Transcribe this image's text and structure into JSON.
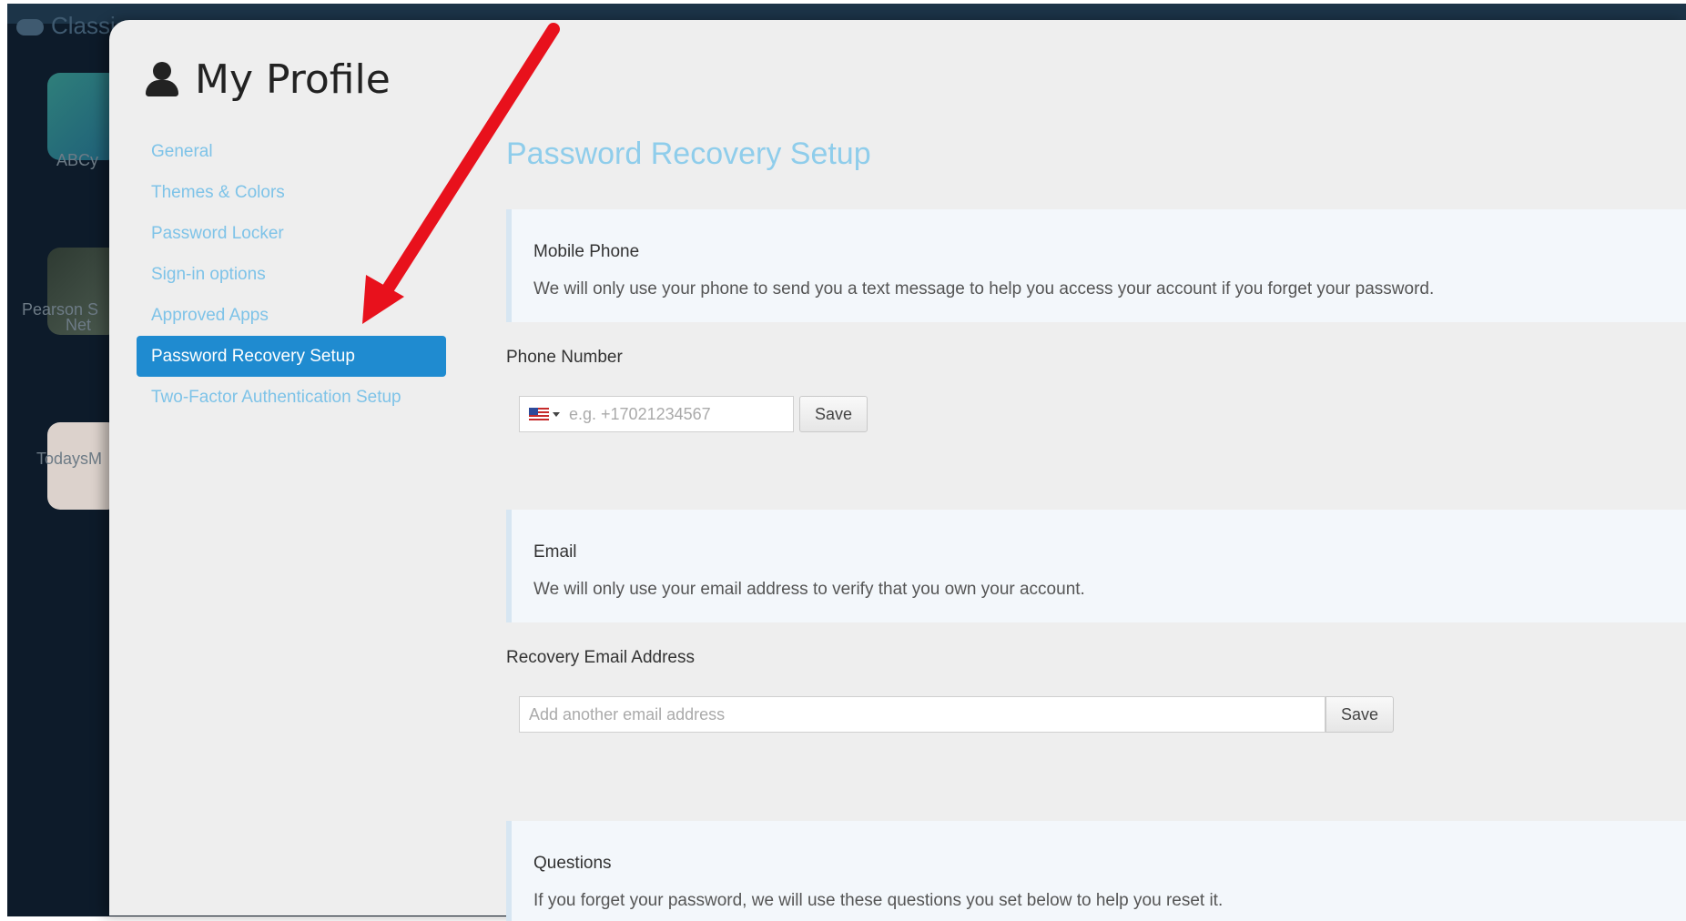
{
  "background": {
    "brand_text": "Classi",
    "tiles": [
      {
        "label": "ABCy"
      },
      {
        "label": "Pearson S"
      },
      {
        "label": "Net"
      },
      {
        "label": "TodaysM"
      }
    ]
  },
  "profile": {
    "title": "My Profile"
  },
  "nav": {
    "items": [
      {
        "label": "General"
      },
      {
        "label": "Themes & Colors"
      },
      {
        "label": "Password Locker"
      },
      {
        "label": "Sign-in options"
      },
      {
        "label": "Approved Apps"
      },
      {
        "label": "Password Recovery Setup",
        "active": true
      },
      {
        "label": "Two-Factor Authentication Setup"
      }
    ]
  },
  "page": {
    "section_title": "Password Recovery Setup"
  },
  "mobile": {
    "title": "Mobile Phone",
    "description": "We will only use your phone to send you a text message to help you access your account if you forget your password.",
    "field_label": "Phone Number",
    "placeholder": "e.g. +17021234567",
    "save_label": "Save",
    "country_icon": "us-flag-icon"
  },
  "email": {
    "title": "Email",
    "description": "We will only use your email address to verify that you own your account.",
    "field_label": "Recovery Email Address",
    "placeholder": "Add another email address",
    "save_label": "Save"
  },
  "questions": {
    "title": "Questions",
    "description": "If you forget your password, we will use these questions you set below to help you reset it."
  },
  "colors": {
    "accent": "#1f8bd0",
    "link": "#7ec3e8",
    "annotation_arrow": "#e8111c"
  }
}
